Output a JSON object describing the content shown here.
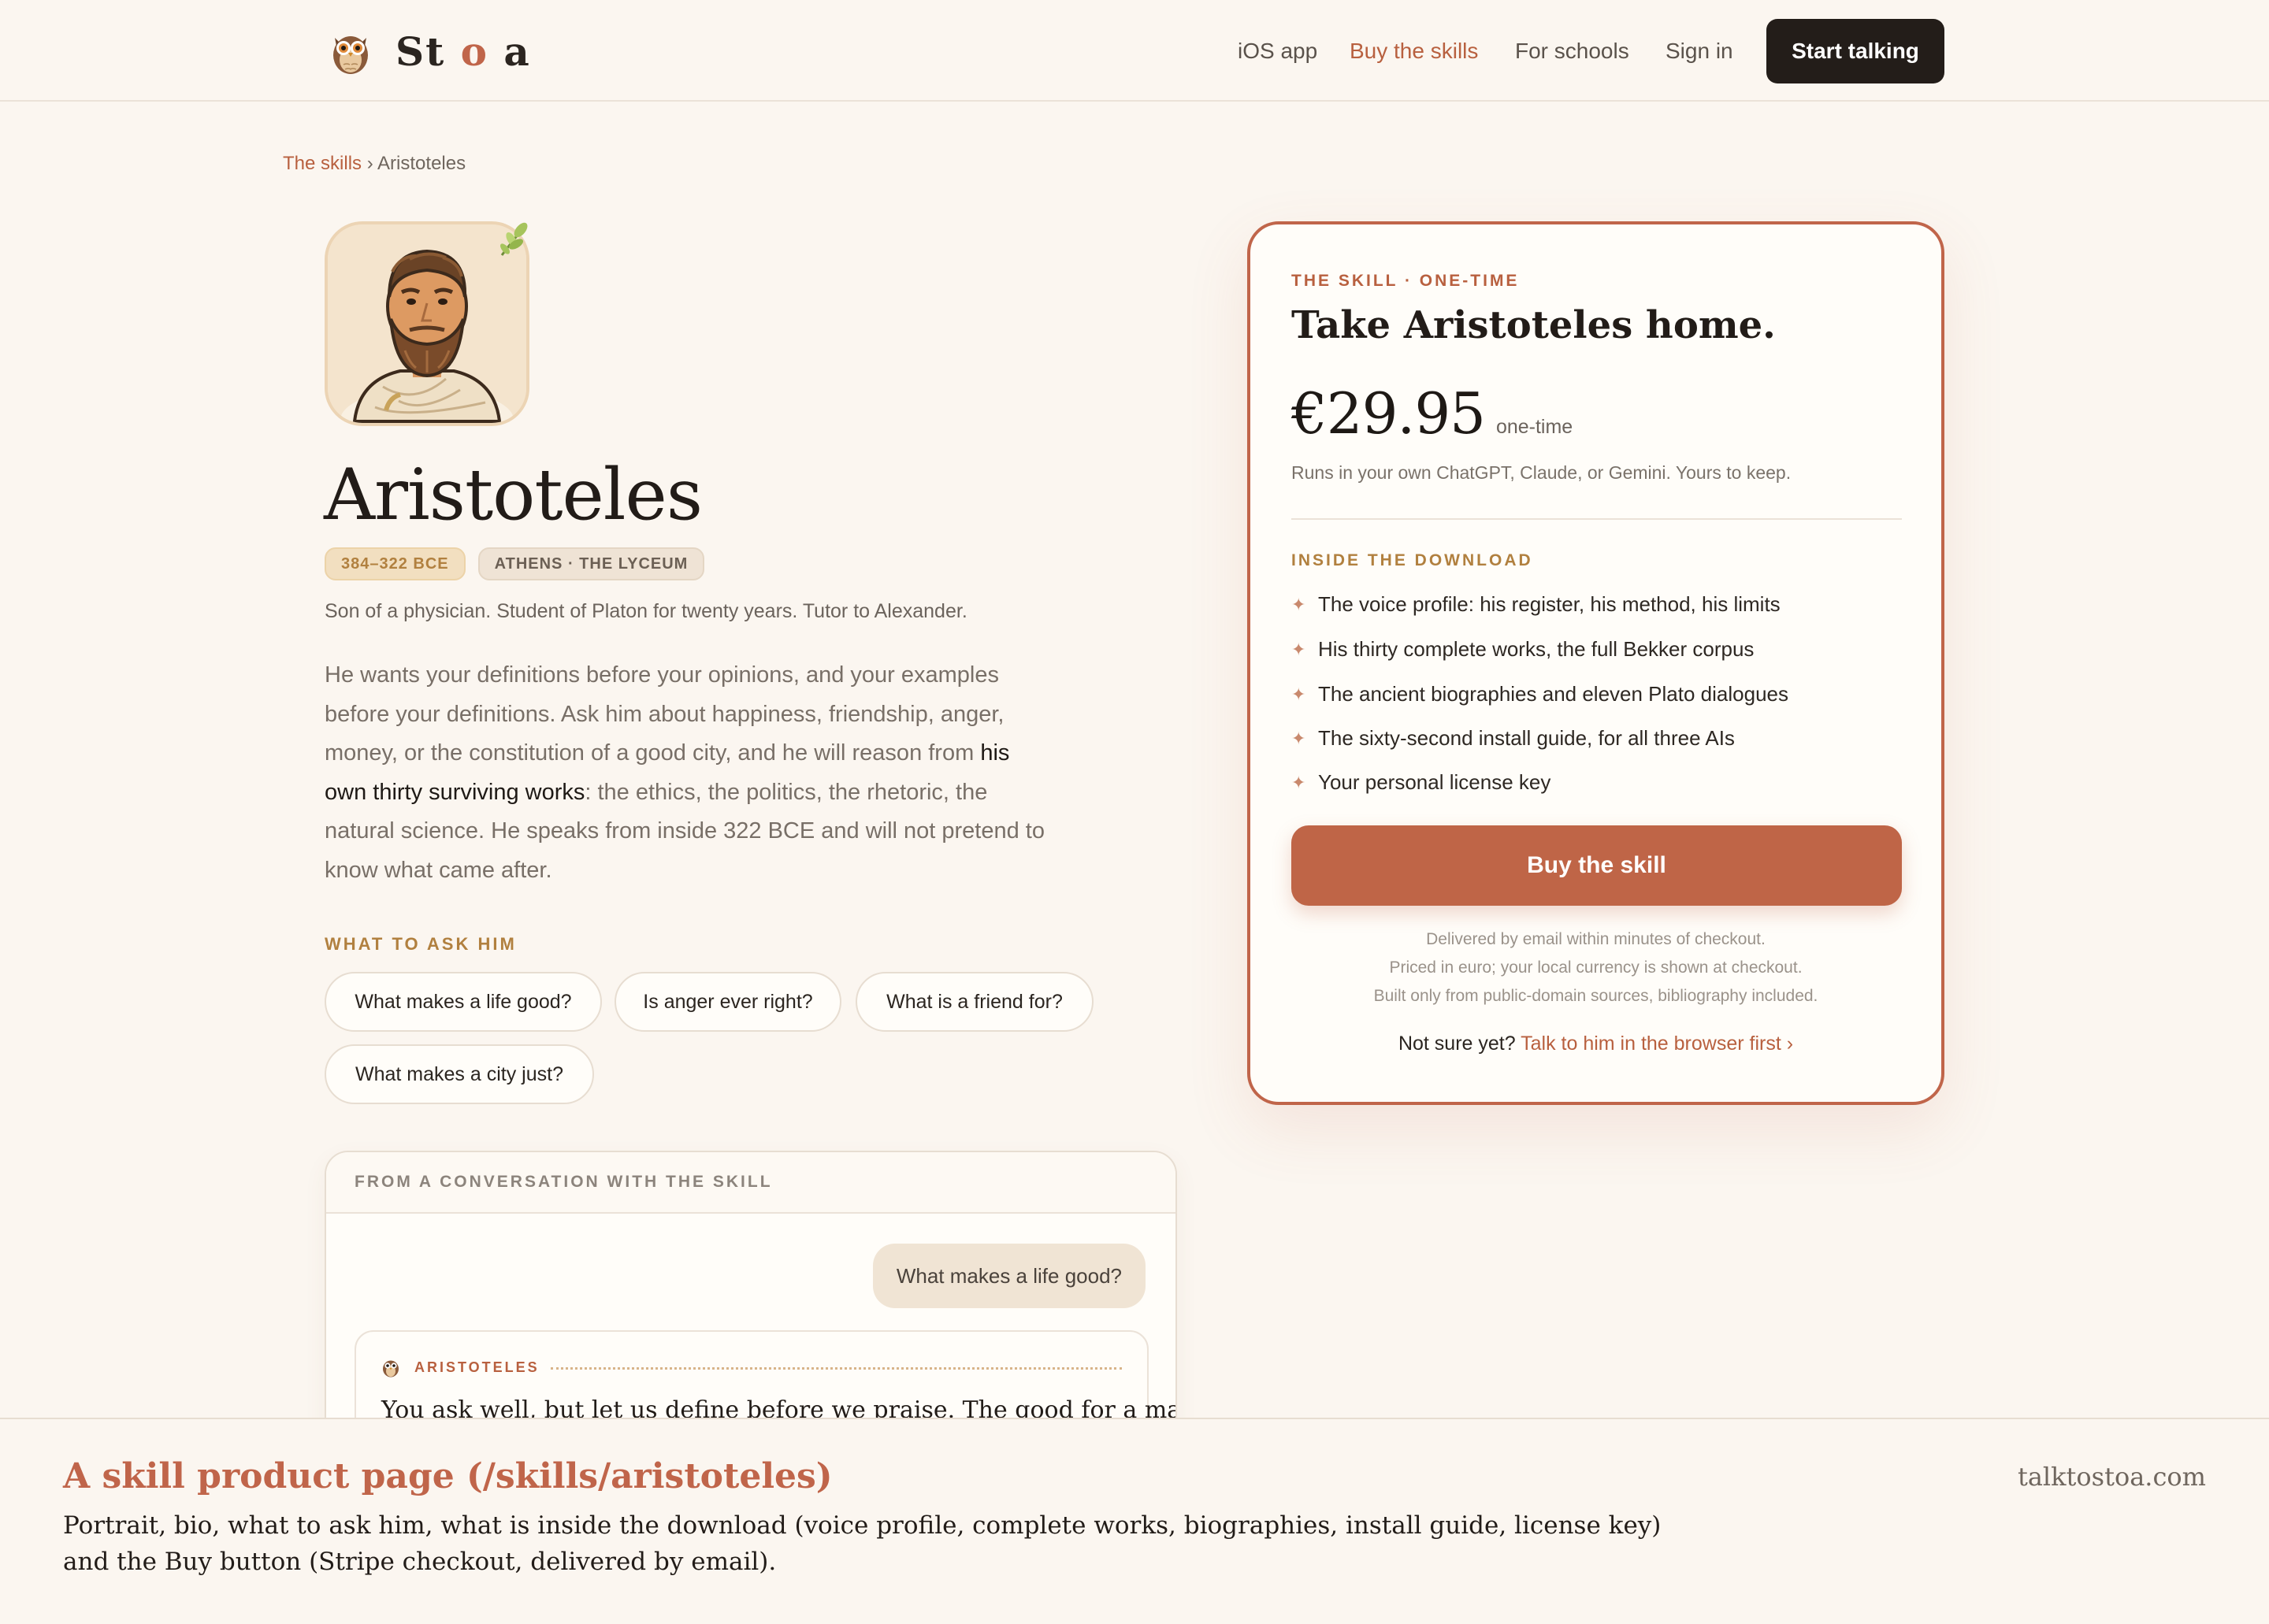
{
  "brand": {
    "name_start": "St",
    "name_o": "o",
    "name_end": "a"
  },
  "nav": {
    "ios": "iOS app",
    "buy": "Buy the skills",
    "schools": "For schools",
    "signin": "Sign in",
    "cta": "Start talking"
  },
  "breadcrumb": {
    "parent": "The skills",
    "separator": "›",
    "current": "Aristoteles"
  },
  "profile": {
    "name": "Aristoteles",
    "dates": "384–322 BCE",
    "place": "ATHENS · THE LYCEUM",
    "bio": "Son of a physician. Student of Platon for twenty years. Tutor to Alexander.",
    "desc_part1": "He wants your definitions before your opinions, and your examples before your definitions. Ask him about happiness, friendship, anger, money, or the constitution of a good city, and he will reason from ",
    "desc_strong": "his own thirty surviving works",
    "desc_part2": ": the ethics, the politics, the rhetoric, the natural science. He speaks from inside 322 BCE and will not pretend to know what came after."
  },
  "ask": {
    "title": "WHAT TO ASK HIM",
    "questions": [
      "What makes a life good?",
      "Is anger ever right?",
      "What is a friend for?",
      "What makes a city just?"
    ]
  },
  "conversation": {
    "title": "FROM A CONVERSATION WITH THE SKILL",
    "user_message": "What makes a life good?",
    "speaker": "ARISTOTELES",
    "reply": "You ask well, but let us define before we praise. The good for a man"
  },
  "card": {
    "eyebrow": "THE SKILL · ONE-TIME",
    "title": "Take Aristoteles home.",
    "price": "€29.95",
    "price_note": "one-time",
    "runs": "Runs in your own ChatGPT, Claude, or Gemini. Yours to keep.",
    "inside_title": "INSIDE THE DOWNLOAD",
    "features": [
      "The voice profile: his register, his method, his limits",
      "His thirty complete works, the full Bekker corpus",
      "The ancient biographies and eleven Plato dialogues",
      "The sixty-second install guide, for all three AIs",
      "Your personal license key"
    ],
    "buy_label": "Buy the skill",
    "fine": [
      "Delivered by email within minutes of checkout.",
      "Priced in euro; your local currency is shown at checkout.",
      "Built only from public-domain sources, bibliography included."
    ],
    "notsure_prefix": "Not sure yet? ",
    "notsure_link": "Talk to him in the browser first ›"
  },
  "caption": {
    "title": "A skill product page (/skills/aristoteles)",
    "domain": "talktostoa.com",
    "body": "Portrait, bio, what to ask him, what is inside the download (voice profile, complete works, biographies, install guide, license key) and the Buy button (Stripe checkout, delivered by email)."
  },
  "colors": {
    "accent": "#c0654a",
    "background": "#fbf6f0",
    "dark_button": "#231d19",
    "gold": "#b1803f"
  },
  "icons": [
    "owl-logo-icon",
    "olive-leaf-icon",
    "sparkle-bullet-icon",
    "owl-avatar-icon"
  ]
}
